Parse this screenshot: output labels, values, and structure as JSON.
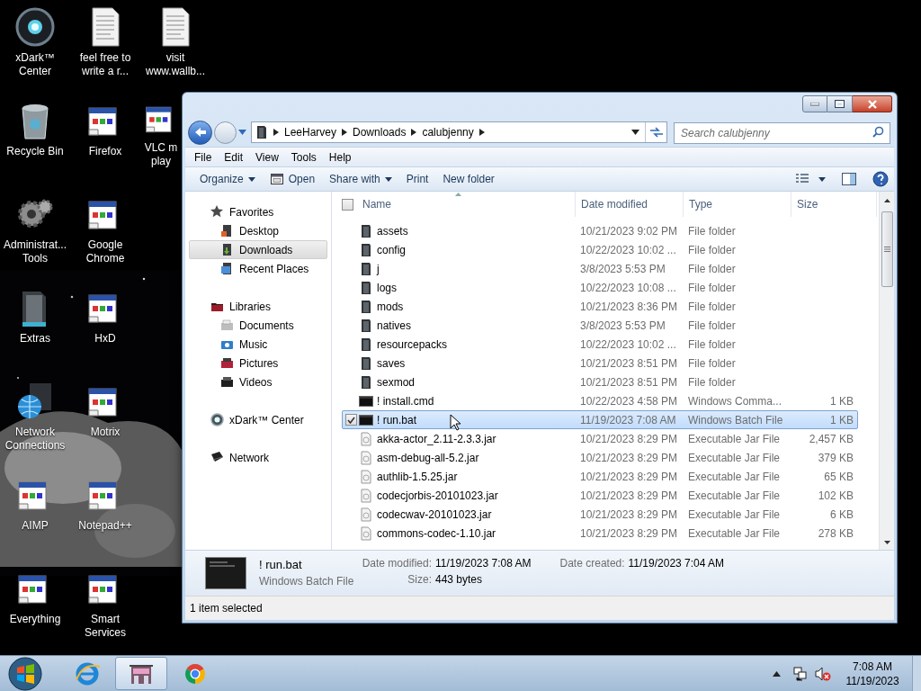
{
  "desktop": {
    "icons": [
      {
        "kind": "orb",
        "label_lines": [
          "xDark™",
          "Center"
        ]
      },
      {
        "kind": "recycle-bin",
        "label_lines": [
          "Recycle Bin"
        ]
      },
      {
        "kind": "gears",
        "label_lines": [
          "Administrat...",
          "Tools"
        ]
      },
      {
        "kind": "folder",
        "label_lines": [
          "Extras"
        ]
      },
      {
        "kind": "globe",
        "label_lines": [
          "Network",
          "Connections"
        ]
      },
      {
        "kind": "app",
        "label_lines": [
          "AIMP"
        ]
      },
      {
        "kind": "app",
        "label_lines": [
          "Everything"
        ]
      },
      {
        "kind": "document",
        "label_lines": [
          "feel free to",
          "write a r..."
        ]
      },
      {
        "kind": "app",
        "label_lines": [
          "Firefox"
        ]
      },
      {
        "kind": "app",
        "label_lines": [
          "Google",
          "Chrome"
        ]
      },
      {
        "kind": "app",
        "label_lines": [
          "HxD"
        ]
      },
      {
        "kind": "app",
        "label_lines": [
          "Motrix"
        ]
      },
      {
        "kind": "app",
        "label_lines": [
          "Notepad++"
        ]
      },
      {
        "kind": "app",
        "label_lines": [
          "Smart",
          "Services"
        ]
      },
      {
        "kind": "document",
        "label_lines": [
          "visit",
          "www.wallb..."
        ]
      },
      {
        "kind": "app",
        "label_lines": [
          "VLC m",
          "play"
        ]
      }
    ]
  },
  "window": {
    "address": {
      "crumbs": [
        "LeeHarvey",
        "Downloads",
        "calubjenny"
      ]
    },
    "search": {
      "placeholder": "Search calubjenny"
    },
    "menu": [
      "File",
      "Edit",
      "View",
      "Tools",
      "Help"
    ],
    "toolbar": [
      {
        "kind": "dropdown",
        "label": "Organize"
      },
      {
        "kind": "open",
        "label": "Open"
      },
      {
        "kind": "dropdown",
        "label": "Share with"
      },
      {
        "kind": "plain",
        "label": "Print"
      },
      {
        "kind": "plain",
        "label": "New folder"
      }
    ],
    "nav": [
      {
        "kind": "star",
        "label": "Favorites",
        "selected": false,
        "children": [
          {
            "kind": "desktop",
            "label": "Desktop",
            "selected": false
          },
          {
            "kind": "downloads",
            "label": "Downloads",
            "selected": true
          },
          {
            "kind": "recent",
            "label": "Recent Places",
            "selected": false
          }
        ]
      },
      {
        "kind": "libraries",
        "label": "Libraries",
        "selected": false,
        "children": [
          {
            "kind": "documents",
            "label": "Documents",
            "selected": false
          },
          {
            "kind": "music",
            "label": "Music",
            "selected": false
          },
          {
            "kind": "pictures",
            "label": "Pictures",
            "selected": false
          },
          {
            "kind": "videos",
            "label": "Videos",
            "selected": false
          }
        ]
      },
      {
        "kind": "orb",
        "label": "xDark™ Center",
        "selected": false
      },
      {
        "kind": "network",
        "label": "Network",
        "selected": false
      }
    ],
    "columns": [
      "Name",
      "Date modified",
      "Type",
      "Size"
    ],
    "select_all_checked": false,
    "rows": [
      {
        "kind": "folder",
        "name": "assets",
        "date": "10/21/2023 9:02 PM",
        "type": "File folder",
        "selected": false,
        "checked": false
      },
      {
        "kind": "folder",
        "name": "config",
        "date": "10/22/2023 10:02 ...",
        "type": "File folder",
        "selected": false,
        "checked": false
      },
      {
        "kind": "folder",
        "name": "j",
        "date": "3/8/2023 5:53 PM",
        "type": "File folder",
        "selected": false,
        "checked": false
      },
      {
        "kind": "folder",
        "name": "logs",
        "date": "10/22/2023 10:08 ...",
        "type": "File folder",
        "selected": false,
        "checked": false
      },
      {
        "kind": "folder",
        "name": "mods",
        "date": "10/21/2023 8:36 PM",
        "type": "File folder",
        "selected": false,
        "checked": false
      },
      {
        "kind": "folder",
        "name": "natives",
        "date": "3/8/2023 5:53 PM",
        "type": "File folder",
        "selected": false,
        "checked": false
      },
      {
        "kind": "folder",
        "name": "resourcepacks",
        "date": "10/22/2023 10:02 ...",
        "type": "File folder",
        "selected": false,
        "checked": false
      },
      {
        "kind": "folder",
        "name": "saves",
        "date": "10/21/2023 8:51 PM",
        "type": "File folder",
        "selected": false,
        "checked": false
      },
      {
        "kind": "folder",
        "name": "sexmod",
        "date": "10/21/2023 8:51 PM",
        "type": "File folder",
        "selected": false,
        "checked": false
      },
      {
        "kind": "script",
        "name": "! install.cmd",
        "date": "10/22/2023 4:58 PM",
        "type": "Windows Comma...",
        "size": "1 KB",
        "selected": false,
        "checked": false
      },
      {
        "kind": "script",
        "name": "! run.bat",
        "date": "11/19/2023 7:08 AM",
        "type": "Windows Batch File",
        "size": "1 KB",
        "selected": true,
        "checked": true
      },
      {
        "kind": "jar",
        "name": "akka-actor_2.11-2.3.3.jar",
        "date": "10/21/2023 8:29 PM",
        "type": "Executable Jar File",
        "size": "2,457 KB",
        "selected": false,
        "checked": false
      },
      {
        "kind": "jar",
        "name": "asm-debug-all-5.2.jar",
        "date": "10/21/2023 8:29 PM",
        "type": "Executable Jar File",
        "size": "379 KB",
        "selected": false,
        "checked": false
      },
      {
        "kind": "jar",
        "name": "authlib-1.5.25.jar",
        "date": "10/21/2023 8:29 PM",
        "type": "Executable Jar File",
        "size": "65 KB",
        "selected": false,
        "checked": false
      },
      {
        "kind": "jar",
        "name": "codecjorbis-20101023.jar",
        "date": "10/21/2023 8:29 PM",
        "type": "Executable Jar File",
        "size": "102 KB",
        "selected": false,
        "checked": false
      },
      {
        "kind": "jar",
        "name": "codecwav-20101023.jar",
        "date": "10/21/2023 8:29 PM",
        "type": "Executable Jar File",
        "size": "6 KB",
        "selected": false,
        "checked": false
      },
      {
        "kind": "jar",
        "name": "commons-codec-1.10.jar",
        "date": "10/21/2023 8:29 PM",
        "type": "Executable Jar File",
        "size": "278 KB",
        "selected": false,
        "checked": false
      }
    ],
    "details": {
      "name": "! run.bat",
      "type": "Windows Batch File",
      "fields": [
        {
          "label": "Date modified:",
          "value": "11/19/2023 7:08 AM"
        },
        {
          "label": "Size:",
          "value": "443 bytes"
        },
        {
          "label": "Date created:",
          "value": "11/19/2023 7:04 AM"
        }
      ]
    },
    "status": "1 item selected"
  },
  "taskbar": {
    "apps": [
      {
        "kind": "ie",
        "selected": false
      },
      {
        "kind": "explorer",
        "selected": true
      },
      {
        "kind": "chrome",
        "selected": false
      }
    ],
    "time": "7:08 AM",
    "date": "11/19/2023"
  }
}
